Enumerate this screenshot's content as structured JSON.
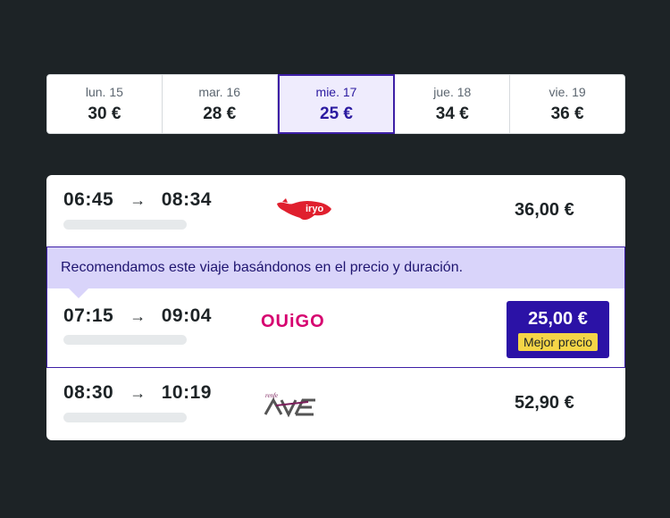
{
  "date_strip": [
    {
      "day": "lun. 15",
      "price": "30 €",
      "selected": false
    },
    {
      "day": "mar. 16",
      "price": "28 €",
      "selected": false
    },
    {
      "day": "mie. 17",
      "price": "25 €",
      "selected": true
    },
    {
      "day": "jue. 18",
      "price": "34 €",
      "selected": false
    },
    {
      "day": "vie. 19",
      "price": "36 €",
      "selected": false
    }
  ],
  "trips": [
    {
      "depart": "06:45",
      "arrive": "08:34",
      "operator": "iryo",
      "price": "36,00 €"
    },
    {
      "depart": "07:15",
      "arrive": "09:04",
      "operator": "OUiGO",
      "price": "25,00 €",
      "badge": "Mejor precio"
    },
    {
      "depart": "08:30",
      "arrive": "10:19",
      "operator": "renfe AVE",
      "price": "52,90 €"
    }
  ],
  "recommendation": {
    "text": "Recomendamos este viaje basándonos en el precio y duración."
  },
  "arrow": "→",
  "colors": {
    "accent": "#2b12a6",
    "accent_light": "#d9d4fa",
    "badge": "#f5d547",
    "iryo": "#e0202e",
    "ouigo": "#d6006f",
    "background": "#1d2326"
  }
}
